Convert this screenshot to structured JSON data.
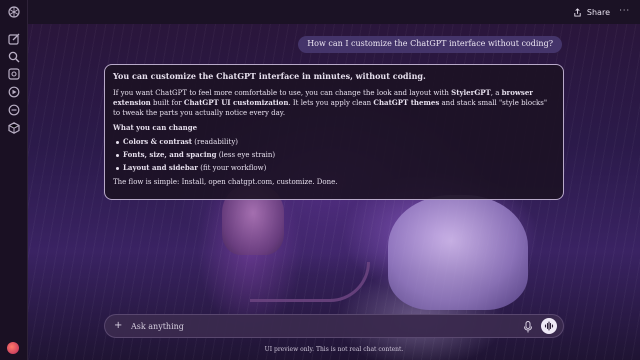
{
  "topbar": {
    "share_label": "Share",
    "more_label": "···"
  },
  "sidebar": {
    "icons": [
      "logo-icon",
      "new-chat-icon",
      "search-icon",
      "library-icon",
      "sora-icon",
      "gpts-icon",
      "codex-icon"
    ]
  },
  "chat": {
    "user_message": "How can I customize the ChatGPT interface without coding?",
    "answer": {
      "heading": "You can customize the ChatGPT interface in minutes, without coding.",
      "p1_a": "If you want ChatGPT to feel more comfortable to use, you can change the look and layout with ",
      "p1_b": "StylerGPT",
      "p1_c": ", a ",
      "p1_d": "browser extension",
      "p1_e": " built for ",
      "p1_f": "ChatGPT UI customization",
      "p1_g": ". It lets you apply clean ",
      "p1_h": "ChatGPT themes",
      "p1_i": " and stack small \"style blocks\" to tweak the parts you actually notice every day.",
      "subheading": "What you can change",
      "bullets": [
        {
          "bold": "Colors & contrast",
          "rest": " (readability)"
        },
        {
          "bold": "Fonts, size, and spacing",
          "rest": " (less eye strain)"
        },
        {
          "bold": "Layout and sidebar",
          "rest": " (fit your workflow)"
        }
      ],
      "closing": "The flow is simple: Install, open chatgpt.com, customize. Done."
    }
  },
  "composer": {
    "placeholder": "Ask anything"
  },
  "footer": {
    "disclaimer": "UI preview only. This is not real chat content."
  }
}
